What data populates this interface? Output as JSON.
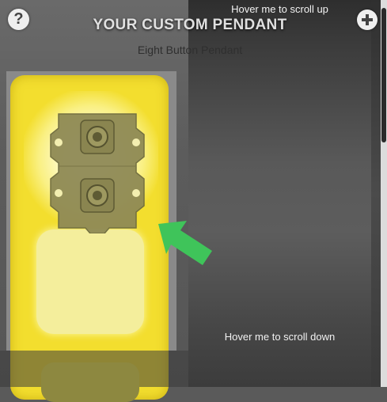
{
  "header": {
    "title": "YOUR CUSTOM PENDANT",
    "subtitle": "Eight Button Pendant",
    "help_icon_glyph": "?",
    "help_icon": "question-icon",
    "add_icon": "plus-icon"
  },
  "scroll_panel": {
    "scroll_up_label": "Hover me to scroll up",
    "scroll_down_label": "Hover me to scroll down"
  },
  "pendant": {
    "body_color": "#f3de2e",
    "component": "button-insert-icon",
    "highlight_arrow_color": "#3fc45a"
  }
}
